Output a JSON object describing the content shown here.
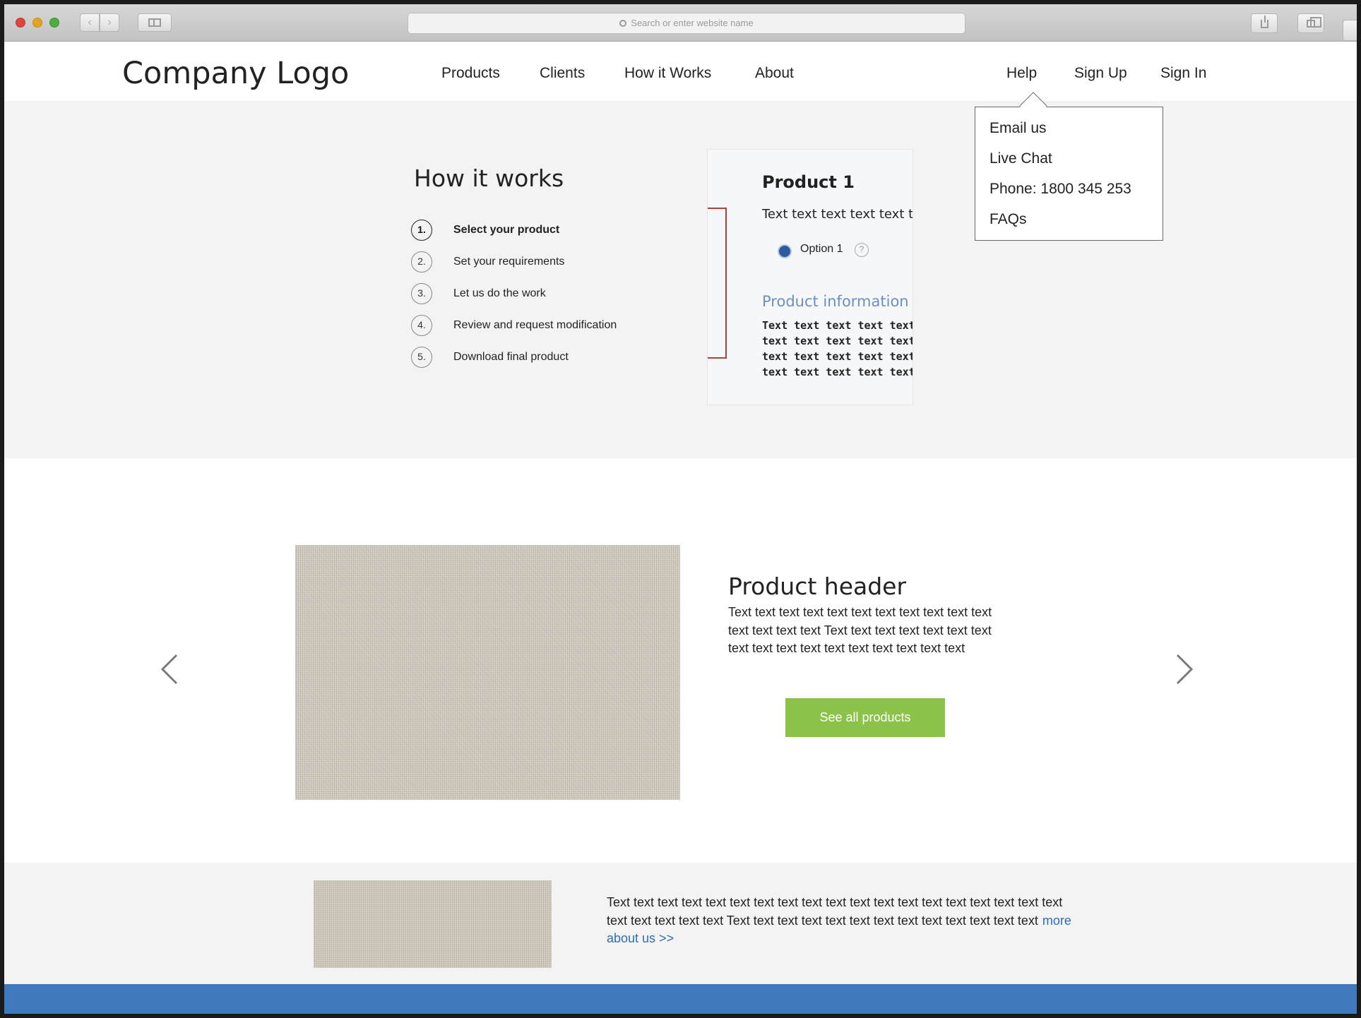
{
  "browser": {
    "address_placeholder": "Search or enter website name"
  },
  "header": {
    "logo": "Company Logo",
    "nav": [
      "Products",
      "Clients",
      "How it Works",
      "About"
    ],
    "right_nav": [
      "Help",
      "Sign Up",
      "Sign In"
    ]
  },
  "help_menu": {
    "items": [
      "Email us",
      "Live Chat",
      "Phone: 1800 345 253",
      "FAQs"
    ]
  },
  "how_it_works": {
    "title": "How it works",
    "steps": [
      {
        "num": "1.",
        "label": "Select your product",
        "active": true
      },
      {
        "num": "2.",
        "label": "Set your requirements",
        "active": false
      },
      {
        "num": "3.",
        "label": "Let us do the work",
        "active": false
      },
      {
        "num": "4.",
        "label": "Review and request modification",
        "active": false
      },
      {
        "num": "5.",
        "label": "Download final product",
        "active": false
      }
    ]
  },
  "preview": {
    "title": "Product 1",
    "text": "Text text text text text te",
    "option": "Option 1",
    "help_glyph": "?",
    "info_title": "Product information",
    "lines": [
      "Text text text text text text",
      "text text text text text text",
      "text text text text text text",
      "text text text text text text"
    ]
  },
  "carousel": {
    "title": "Product header",
    "body": "Text text text text text text text text text text text text text text text Text text text text text text text text text text text text text text text text text",
    "button": "See all products",
    "prev_glyph": "<",
    "next_glyph": ">"
  },
  "about": {
    "body": "Text text text text text text text text text text text text text text text text text text text text text text text text Text text text text text text text text text text text text text",
    "link": "more about us >>"
  },
  "colors": {
    "accent_green": "#8bc34a",
    "footer_blue": "#3f7abd",
    "link_blue": "#2f6db4",
    "band_grey": "#f2f3f2"
  }
}
